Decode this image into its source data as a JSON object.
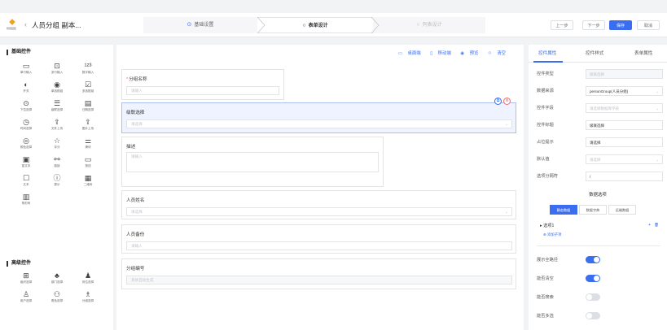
{
  "header": {
    "logo_text": "智慧园区",
    "logo_icon": "logo-icon",
    "back_glyph": "‹",
    "title": "人员分组 副本...",
    "steps": [
      {
        "label": "基础设置",
        "icon": "check-circle-icon",
        "glyph": "⊙"
      },
      {
        "label": "表单设计",
        "icon": "circle-icon",
        "glyph": "○"
      },
      {
        "label": "列表设计",
        "icon": "circle-icon",
        "glyph": "○"
      }
    ],
    "buttons": {
      "prev": "上一步",
      "next": "下一步",
      "save": "保存",
      "cancel": "取消"
    },
    "colors": {
      "accent": "#3a6df0"
    }
  },
  "palette": {
    "basic_title": "基础控件",
    "advanced_title": "高级控件",
    "basic": [
      {
        "label": "单行输入",
        "glyph": "▭",
        "icon": "single-input-icon"
      },
      {
        "label": "多行输入",
        "glyph": "⊡",
        "icon": "multi-input-icon"
      },
      {
        "label": "数字输入",
        "glyph": "¹²³",
        "icon": "number-input-icon"
      },
      {
        "label": "开关",
        "glyph": "◐",
        "icon": "switch-icon"
      },
      {
        "label": "单选框组",
        "glyph": "◉",
        "icon": "radio-icon"
      },
      {
        "label": "多选框组",
        "glyph": "☑",
        "icon": "checkbox-icon"
      },
      {
        "label": "下拉选择",
        "glyph": "⊙",
        "icon": "select-icon"
      },
      {
        "label": "级联选择",
        "glyph": "☰",
        "icon": "cascader-icon"
      },
      {
        "label": "日期选择",
        "glyph": "▤",
        "icon": "date-icon"
      },
      {
        "label": "时间选择",
        "glyph": "◷",
        "icon": "time-icon"
      },
      {
        "label": "文件上传",
        "glyph": "⇪",
        "icon": "file-upload-icon"
      },
      {
        "label": "图片上传",
        "glyph": "⇪",
        "icon": "image-upload-icon"
      },
      {
        "label": "颜色选择",
        "glyph": "◎",
        "icon": "color-icon"
      },
      {
        "label": "评分",
        "glyph": "☆",
        "icon": "rate-icon"
      },
      {
        "label": "滑块",
        "glyph": "⚌",
        "icon": "slider-icon"
      },
      {
        "label": "富文本",
        "glyph": "▣",
        "icon": "rich-text-icon"
      },
      {
        "label": "链接",
        "glyph": "⚯",
        "icon": "link-icon"
      },
      {
        "label": "按钮",
        "glyph": "▭",
        "icon": "button-icon"
      },
      {
        "label": "文本",
        "glyph": "☐",
        "icon": "text-icon"
      },
      {
        "label": "提示",
        "glyph": "ⓘ",
        "icon": "tip-icon"
      },
      {
        "label": "二维码",
        "glyph": "▦",
        "icon": "qrcode-icon"
      },
      {
        "label": "条形码",
        "glyph": "▥",
        "icon": "barcode-icon"
      }
    ],
    "advanced": [
      {
        "label": "组织选择",
        "glyph": "⊞",
        "icon": "org-icon"
      },
      {
        "label": "部门选择",
        "glyph": "♣",
        "icon": "dept-icon"
      },
      {
        "label": "岗位选择",
        "glyph": "♟",
        "icon": "post-icon"
      },
      {
        "label": "用户选择",
        "glyph": "♙",
        "icon": "user-icon"
      },
      {
        "label": "角色选择",
        "glyph": "⚇",
        "icon": "role-icon"
      },
      {
        "label": "分组选择",
        "glyph": "♗",
        "icon": "group-icon"
      }
    ]
  },
  "canvas": {
    "tools": [
      {
        "label": "桌面端",
        "glyph": "▭",
        "icon": "desktop-icon"
      },
      {
        "label": "移动端",
        "glyph": "▯",
        "icon": "mobile-icon"
      },
      {
        "label": "预览",
        "glyph": "◉",
        "icon": "preview-icon"
      },
      {
        "label": "清空",
        "glyph": "♲",
        "icon": "clear-icon"
      }
    ],
    "fields": [
      {
        "label": "分组名称",
        "required": "*",
        "placeholder": "请输入"
      },
      {
        "label": "级联选择",
        "placeholder": "请选择",
        "arrow": "⌄"
      },
      {
        "label": "描述",
        "placeholder": "请输入"
      },
      {
        "label": "人员姓名",
        "placeholder": "请选择",
        "arrow": "⌄"
      },
      {
        "label": "人员备份",
        "placeholder": "请输入"
      },
      {
        "label": "分组编号",
        "placeholder": "系统自动生成"
      }
    ],
    "selected_actions": {
      "copy": "⧉",
      "delete": "⊗"
    }
  },
  "props": {
    "tabs": [
      "控件属性",
      "控件样式",
      "表单属性"
    ],
    "rows": [
      {
        "label": "控件类型",
        "value": "级联选择",
        "kind": "dis"
      },
      {
        "label": "数据来源",
        "value": "personGroup(人员分组)",
        "kind": "sel"
      },
      {
        "label": "控件字段",
        "value": "请选择数据库字段",
        "kind": "ph-sel"
      },
      {
        "label": "控件标题",
        "value": "级联选择",
        "kind": "val"
      },
      {
        "label": "占位提示",
        "value": "请选择",
        "kind": "val"
      },
      {
        "label": "默认值",
        "value": "请选择",
        "kind": "ph-sel"
      },
      {
        "label": "选项分隔符",
        "value": "/",
        "kind": "val"
      }
    ],
    "options_title": "数据选项",
    "subtabs": [
      "静态数据",
      "数据字典",
      "远端数据"
    ],
    "option_item": "选项1",
    "option_expand": "▸",
    "option_add_glyph": "+",
    "option_del_glyph": "🗑",
    "option_add_child": "⊕ 添加子项",
    "toggles": [
      {
        "label": "展示全路径",
        "on": true
      },
      {
        "label": "能否清空",
        "on": true
      },
      {
        "label": "能否搜索",
        "on": false
      },
      {
        "label": "能否多选",
        "on": false
      }
    ]
  }
}
